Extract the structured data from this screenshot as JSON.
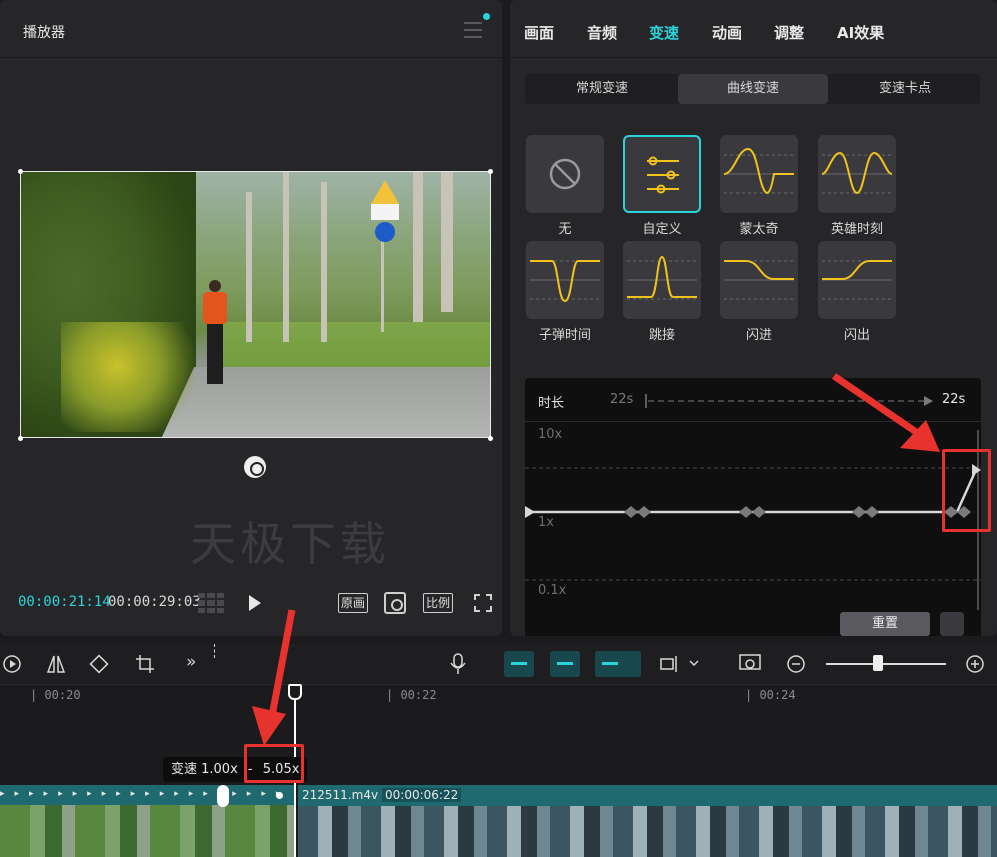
{
  "player": {
    "title": "播放器",
    "watermark": "天极下载",
    "current_time": "00:00:21:14",
    "total_time": "00:00:29:03",
    "btn_original": "原画",
    "btn_ratio": "比例"
  },
  "panel": {
    "tabs": [
      {
        "label": "画面",
        "active": false
      },
      {
        "label": "音频",
        "active": false
      },
      {
        "label": "变速",
        "active": true
      },
      {
        "label": "动画",
        "active": false
      },
      {
        "label": "调整",
        "active": false
      },
      {
        "label": "AI效果",
        "active": false
      }
    ],
    "subtabs": [
      {
        "label": "常规变速",
        "active": false
      },
      {
        "label": "曲线变速",
        "active": true
      },
      {
        "label": "变速卡点",
        "active": false
      }
    ],
    "presets": [
      {
        "label": "无",
        "icon": "no-icon"
      },
      {
        "label": "自定义",
        "icon": "custom-sliders-icon",
        "selected": true
      },
      {
        "label": "蒙太奇",
        "icon": "montage-curve-icon"
      },
      {
        "label": "英雄时刻",
        "icon": "hero-curve-icon"
      },
      {
        "label": "子弹时间",
        "icon": "bullet-time-curve-icon"
      },
      {
        "label": "跳接",
        "icon": "jump-cut-curve-icon"
      },
      {
        "label": "闪进",
        "icon": "flash-in-curve-icon"
      },
      {
        "label": "闪出",
        "icon": "flash-out-curve-icon"
      }
    ],
    "graph": {
      "duration_label": "时长",
      "duration_from": "22s",
      "duration_to": "22s",
      "y_labels": [
        "10x",
        "1x",
        "0.1x"
      ]
    },
    "reset_label": "重置"
  },
  "timeline": {
    "ticks": [
      "| 00:20",
      "| 00:22",
      "| 00:24"
    ],
    "speed_tooltip_prefix": "变速 1.00x",
    "speed_tooltip_arrow": "-",
    "speed_tooltip_value": "5.05x",
    "clip_name": "212511.m4v",
    "clip_duration": "00:00:06:22"
  },
  "colors": {
    "accent": "#2ad4db",
    "curve": "#f1c21b",
    "highlight": "#e8322e"
  }
}
